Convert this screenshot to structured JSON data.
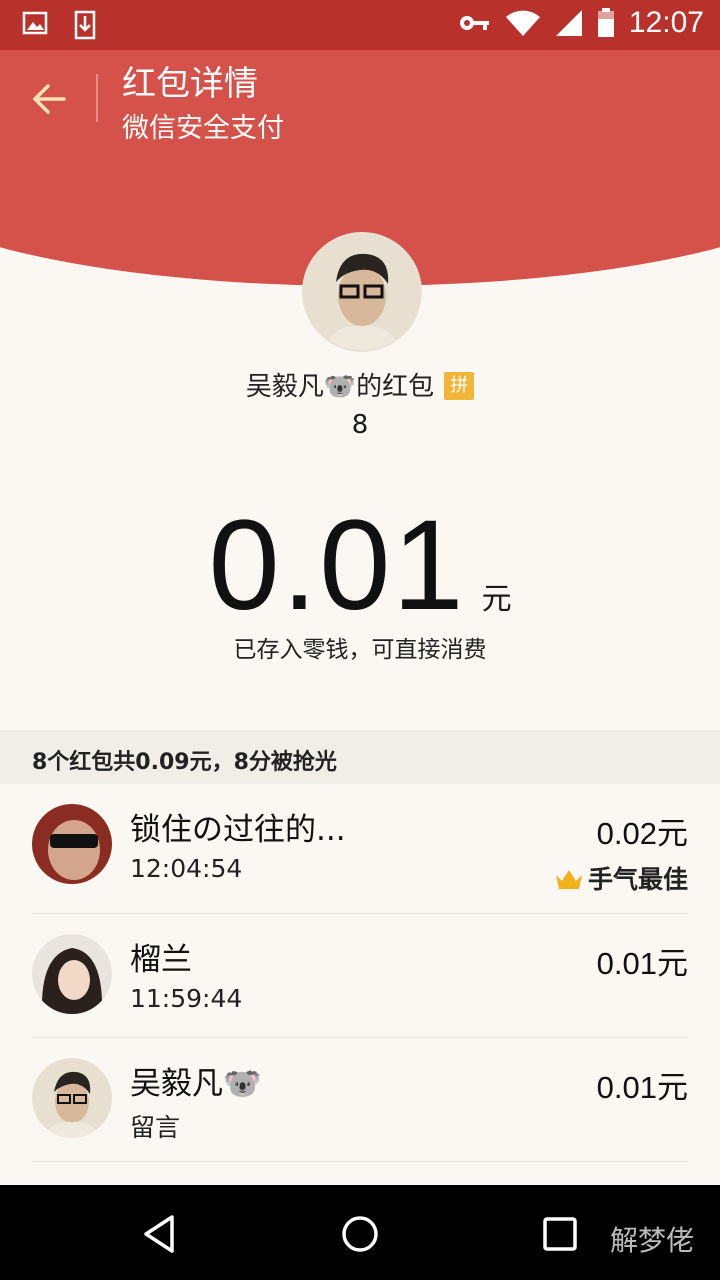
{
  "status_bar": {
    "time": "12:07",
    "icons": [
      "image-icon",
      "download-icon",
      "key-icon",
      "wifi-icon",
      "signal-icon",
      "battery-icon"
    ]
  },
  "header": {
    "title": "红包详情",
    "subtitle": "微信安全支付",
    "back_icon": "back-arrow-icon",
    "background_color": "#d5524a"
  },
  "sender": {
    "name_line": "吴毅凡🐨的红包",
    "badge": "拼",
    "count": "8"
  },
  "received": {
    "amount": "0.01",
    "unit": "元",
    "note": "已存入零钱，可直接消费"
  },
  "summary": "8个红包共0.09元，8分被抢光",
  "recipients": [
    {
      "name": "锁住の过往的...",
      "time": "12:04:54",
      "amount": "0.02元",
      "best_label": "手气最佳",
      "best_icon": "crown-icon"
    },
    {
      "name": "榴兰",
      "time": "11:59:44",
      "amount": "0.01元"
    },
    {
      "name": "吴毅凡🐨",
      "time": "留言",
      "amount": "0.01元"
    }
  ],
  "nav": {
    "icons": [
      "back-triangle-icon",
      "home-circle-icon",
      "recents-square-icon"
    ]
  },
  "watermark": "解梦佬"
}
